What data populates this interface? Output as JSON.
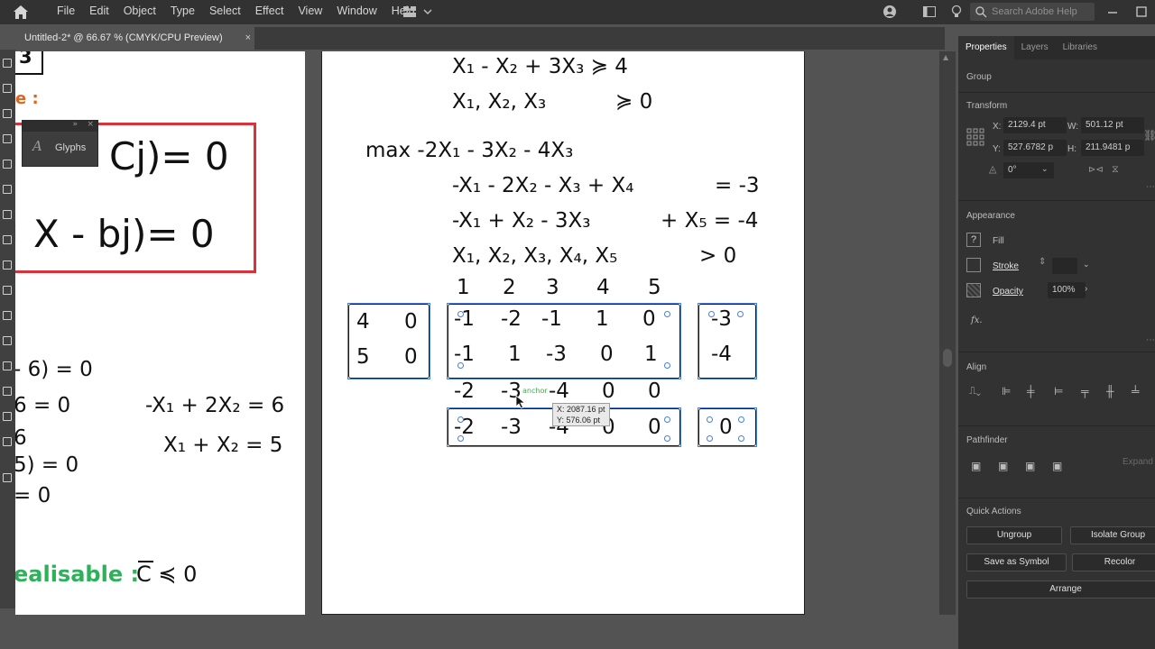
{
  "menu": {
    "items": [
      "File",
      "Edit",
      "Object",
      "Type",
      "Select",
      "Effect",
      "View",
      "Window",
      "Help"
    ],
    "search_placeholder": "Search Adobe Help"
  },
  "document": {
    "tab_title": "Untitled-2* @ 66.67 % (CMYK/CPU Preview)",
    "close": "×"
  },
  "left_art": {
    "top_box_num": "3",
    "e_label": "e :",
    "cj_line": "Cj)= 0",
    "j1": "j",
    "bj_line": "X - bj)= 0",
    "j2": "j",
    "eq1": "- 6) = 0",
    "eq2": "6 = 0",
    "eq3": "-X₁ + 2X₂ = 6",
    "eq4": "6",
    "eq5": "X₁ + X₂ = 5",
    "eq6": "5) = 0",
    "eq7": "= 0",
    "realisable": "ealisable :",
    "cbar": "C ≼ 0"
  },
  "glyphs_panel": {
    "label": "Glyphs",
    "glyph": "A"
  },
  "mid_art": {
    "c1": "X₁ -   X₂ + 3X₃ ≽ 4",
    "c2": "X₁, X₂, X₃",
    "c2b": "≽ 0",
    "obj": "max -2X₁ - 3X₂ - 4X₃",
    "r1": "-X₁ - 2X₂ - X₃ + X₄",
    "r1b": "= -3",
    "r2": "-X₁ +   X₂ - 3X₃",
    "r2b": "+ X₅ = -4",
    "r3": "X₁, X₂, X₃, X₄, X₅",
    "r3b": "> 0",
    "header": [
      "1",
      "2",
      "3",
      "4",
      "5"
    ],
    "basis": [
      [
        "4",
        "0"
      ],
      [
        "5",
        "0"
      ]
    ],
    "matrix": [
      [
        "-1",
        "-2",
        "-1",
        "1",
        "0"
      ],
      [
        "-1",
        "1",
        "-3",
        "0",
        "1"
      ]
    ],
    "rhs": [
      "-3",
      "-4"
    ],
    "cost_row": [
      "-2",
      "-3",
      "-4",
      "0",
      "0"
    ],
    "reduced_row": [
      "-2",
      "-3",
      "-4",
      "0",
      "0"
    ],
    "reduced_rhs": "0",
    "anchor_label": "anchor"
  },
  "tooltip": {
    "x": "X: 2087.16 pt",
    "y": "Y: 576.06 pt"
  },
  "panel": {
    "tabs": [
      "Properties",
      "Layers",
      "Libraries"
    ],
    "group": "Group",
    "transform": "Transform",
    "x_label": "X:",
    "x_val": "2129.4 pt",
    "w_label": "W:",
    "w_val": "501.12 pt",
    "y_label": "Y:",
    "y_val": "527.6782 p",
    "h_label": "H:",
    "h_val": "211.9481 p",
    "angle_val": "0°",
    "appearance": "Appearance",
    "fill": "Fill",
    "stroke": "Stroke",
    "opacity": "Opacity",
    "opacity_val": "100%",
    "fx": "fx.",
    "align": "Align",
    "pathfinder": "Pathfinder",
    "expand": "Expand",
    "quick_actions": "Quick Actions",
    "ungroup": "Ungroup",
    "isolate_group": "Isolate Group",
    "save_as_symbol": "Save as Symbol",
    "recolor": "Recolor",
    "arrange": "Arrange"
  }
}
